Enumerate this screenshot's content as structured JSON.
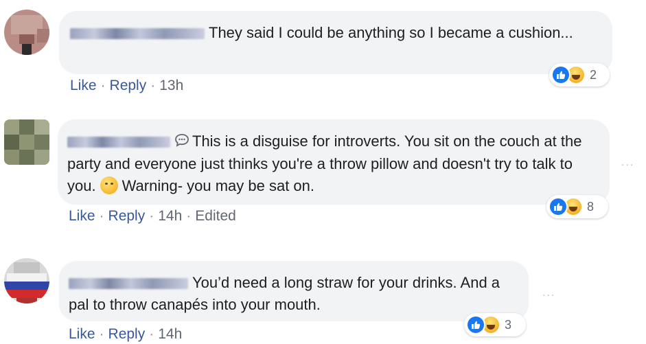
{
  "comments": [
    {
      "text": "They said I could be anything so I became a cushion...",
      "reactions_count": "2",
      "actions": {
        "like": "Like",
        "reply": "Reply",
        "time": "13h",
        "edited": ""
      }
    },
    {
      "text_part1": "This is a disguise for introverts. You sit on the couch at the party and everyone just thinks you're a throw pillow and doesn't try to talk to you.",
      "text_part2": "Warning- you may be sat on.",
      "reactions_count": "8",
      "more": "...",
      "actions": {
        "like": "Like",
        "reply": "Reply",
        "time": "14h",
        "edited": "Edited"
      }
    },
    {
      "text": "You’d need a long straw for your drinks. And a pal to throw canapés into your mouth.",
      "reactions_count": "3",
      "more": "...",
      "actions": {
        "like": "Like",
        "reply": "Reply",
        "time": "14h",
        "edited": ""
      }
    }
  ],
  "icons": {
    "reaction_like": "thumbs-up-icon",
    "reaction_haha": "laughing-face-icon",
    "inline_emoji": "smirk-emoji-icon",
    "comment_badge": "speech-bubble-icon"
  },
  "colors": {
    "bubble_bg": "#f2f3f5",
    "link": "#385898",
    "meta": "#606770",
    "like_blue": "#1877f2",
    "haha_yellow": "#f4b329"
  }
}
